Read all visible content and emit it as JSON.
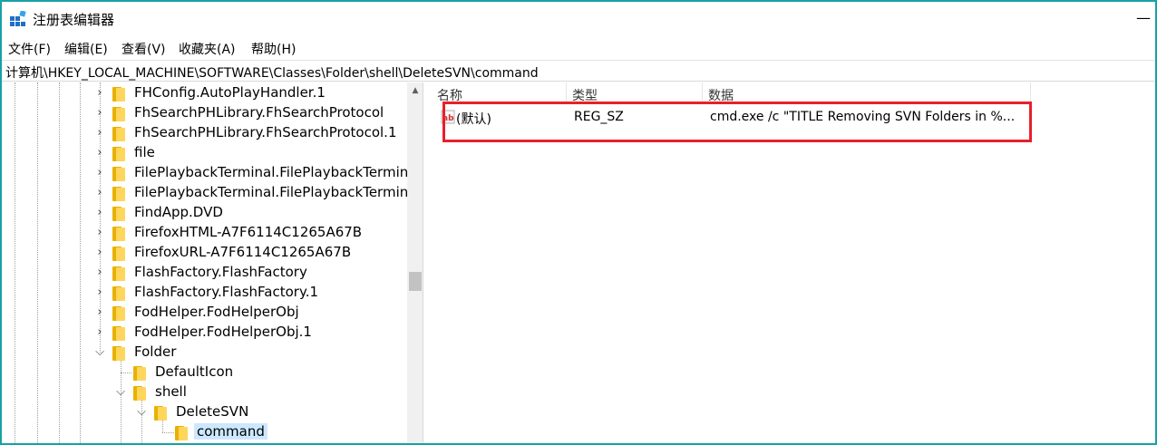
{
  "window": {
    "title": "注册表编辑器"
  },
  "menu": [
    "文件(F)",
    "编辑(E)",
    "查看(V)",
    "收藏夹(A)",
    "帮助(H)"
  ],
  "address": "计算机\\HKEY_LOCAL_MACHINE\\SOFTWARE\\Classes\\Folder\\shell\\DeleteSVN\\command",
  "tree": {
    "items": [
      {
        "label": "FHConfig.AutoPlayHandler.1"
      },
      {
        "label": "FhSearchPHLibrary.FhSearchProtocol"
      },
      {
        "label": "FhSearchPHLibrary.FhSearchProtocol.1"
      },
      {
        "label": "file"
      },
      {
        "label": "FilePlaybackTerminal.FilePlaybackTermina"
      },
      {
        "label": "FilePlaybackTerminal.FilePlaybackTermina"
      },
      {
        "label": "FindApp.DVD"
      },
      {
        "label": "FirefoxHTML-A7F6114C1265A67B"
      },
      {
        "label": "FirefoxURL-A7F6114C1265A67B"
      },
      {
        "label": "FlashFactory.FlashFactory"
      },
      {
        "label": "FlashFactory.FlashFactory.1"
      },
      {
        "label": "FodHelper.FodHelperObj"
      },
      {
        "label": "FodHelper.FodHelperObj.1"
      },
      {
        "label": "Folder"
      },
      {
        "label": "DefaultIcon"
      },
      {
        "label": "shell"
      },
      {
        "label": "DeleteSVN"
      },
      {
        "label": "command"
      }
    ]
  },
  "list": {
    "columns": [
      "名称",
      "类型",
      "数据"
    ],
    "rows": [
      {
        "name": "(默认)",
        "type": "REG_SZ",
        "data": "cmd.exe /c \"TITLE Removing SVN Folders in %..."
      }
    ]
  },
  "colors": {
    "frame": "#17a2a6",
    "highlight": "#e8202a",
    "selection": "#cce8ff"
  }
}
